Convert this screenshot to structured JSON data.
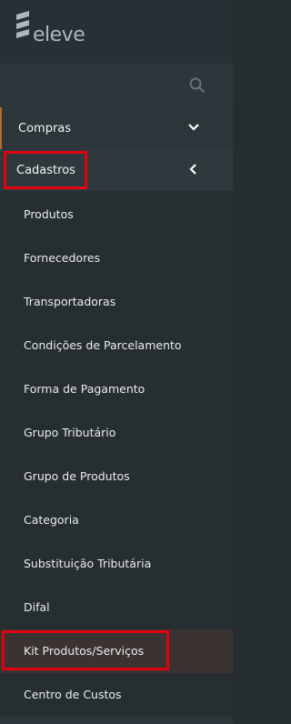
{
  "brand": {
    "logo_text": "eleve"
  },
  "search": {
    "icon": "search-icon"
  },
  "menu": {
    "compras": {
      "label": "Compras",
      "icon": "chevron-down-icon"
    },
    "cadastros": {
      "label": "Cadastros",
      "icon": "chevron-left-icon"
    }
  },
  "submenu": [
    {
      "label": "Produtos"
    },
    {
      "label": "Fornecedores"
    },
    {
      "label": "Transportadoras"
    },
    {
      "label": "Condições de Parcelamento"
    },
    {
      "label": "Forma de Pagamento"
    },
    {
      "label": "Grupo Tributário"
    },
    {
      "label": "Grupo de Produtos"
    },
    {
      "label": "Categoria"
    },
    {
      "label": "Substituição Tributária"
    },
    {
      "label": "Difal"
    },
    {
      "label": "Kit Produtos/Serviços"
    },
    {
      "label": "Centro de Custos"
    }
  ],
  "colors": {
    "accent": "#b86a2c",
    "highlight": "#e3000f",
    "background": "#262e32"
  }
}
